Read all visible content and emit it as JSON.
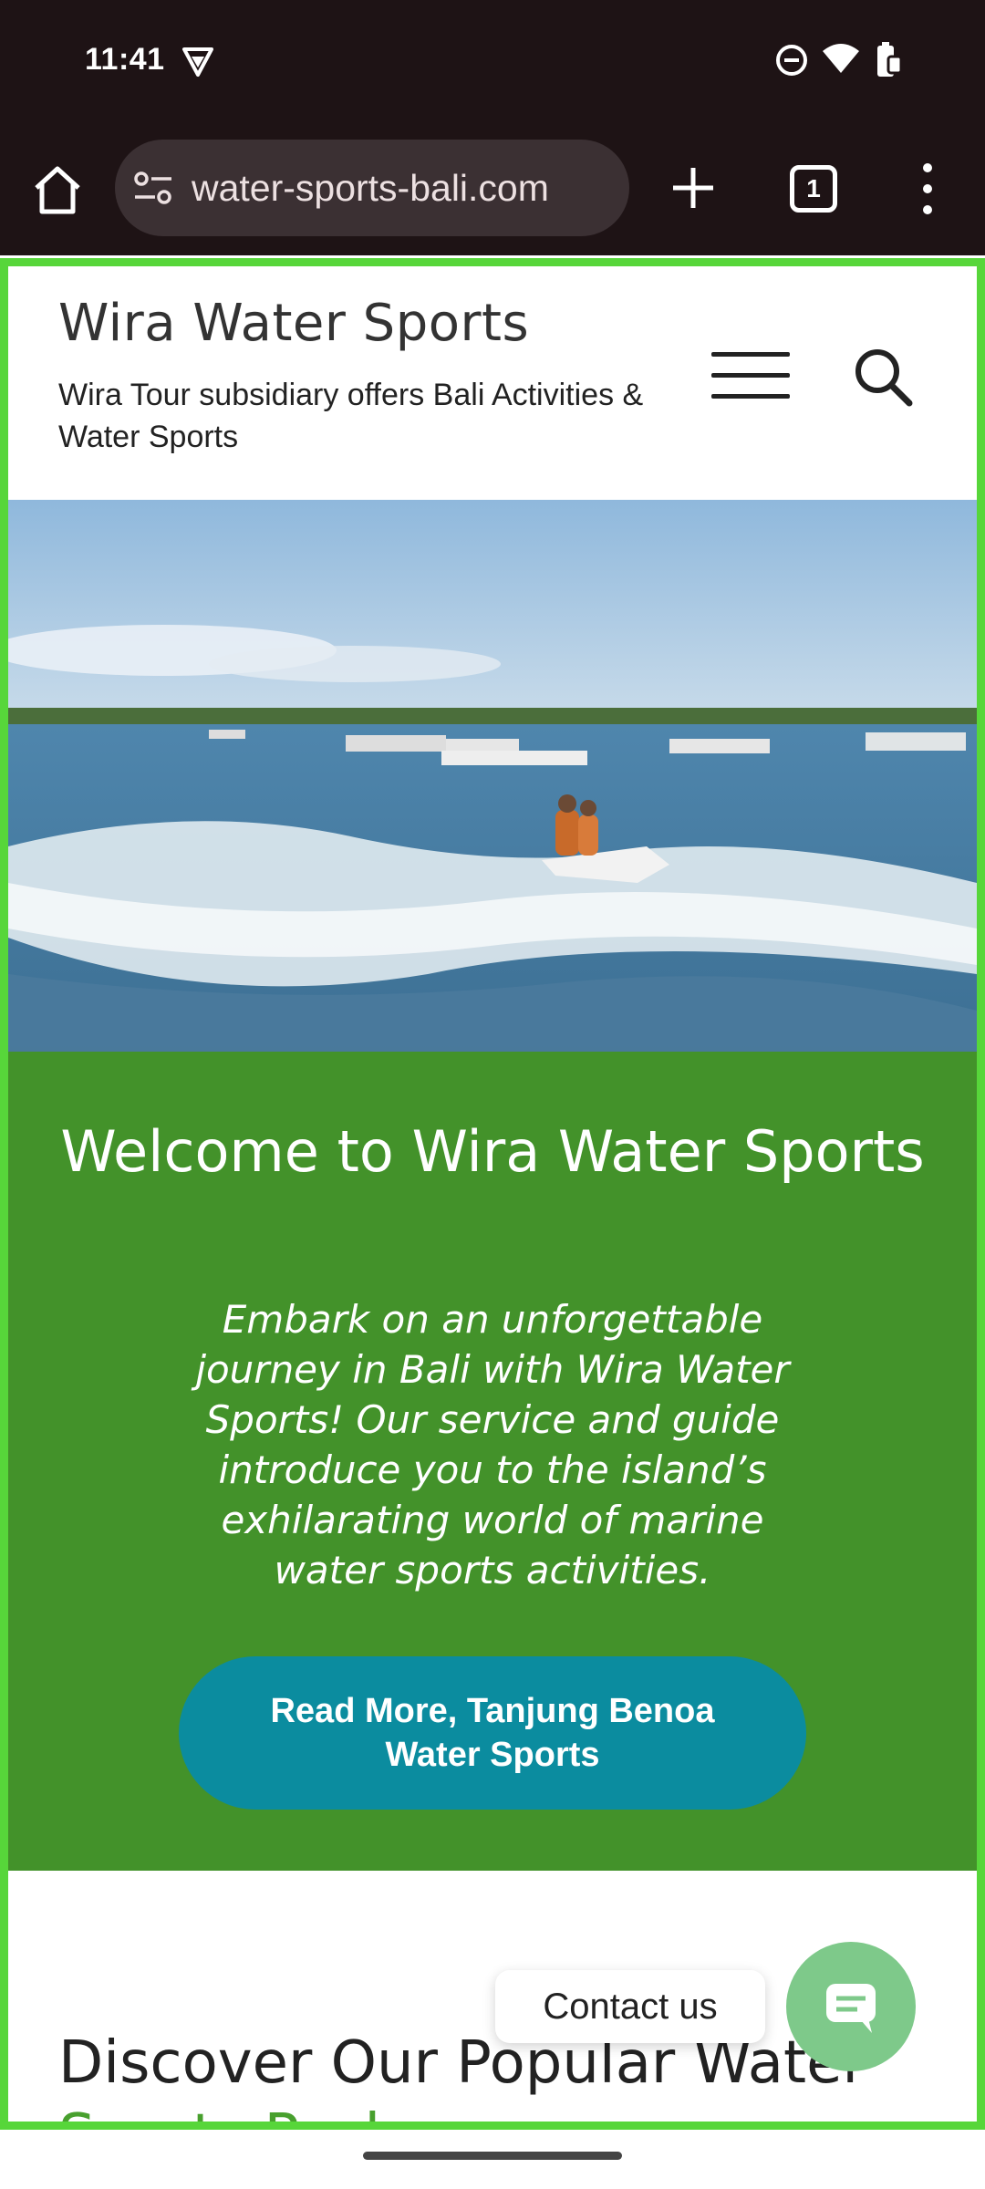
{
  "status_bar": {
    "time": "11:41",
    "icons": [
      "vpn-icon",
      "dnd-icon",
      "wifi-icon",
      "battery-icon"
    ]
  },
  "browser": {
    "url": "water-sports-bali.com",
    "tab_count": "1",
    "icons": [
      "home-icon",
      "tune-icon",
      "plus-icon",
      "tabs-icon",
      "more-vert-icon"
    ]
  },
  "site": {
    "title": "Wira Water Sports",
    "tagline": "Wira Tour subsidiary offers Bali Activities & Water Sports"
  },
  "welcome": {
    "title": "Welcome to Wira Water Sports",
    "text": "Embark on an unforgettable journey in Bali with Wira Water Sports! Our service and guide introduce you to the island’s exhilarating world of marine water sports activities.",
    "button_label": "Read More, Tanjung Benoa Water Sports"
  },
  "discover": {
    "heading": "Discover Our Popular Water",
    "heading_cont": "Sports Packages"
  },
  "contact": {
    "label": "Contact us"
  },
  "colors": {
    "welcome_bg": "#43922a",
    "button_bg": "#0b8c9f",
    "frame": "#57d63a",
    "contact_fab": "#7ec98a"
  }
}
